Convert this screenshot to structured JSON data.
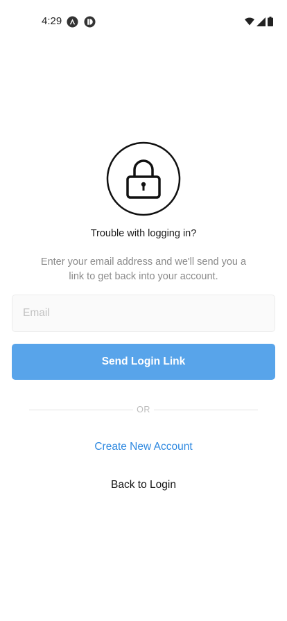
{
  "status_bar": {
    "time": "4:29",
    "icons": [
      "notification-a-icon",
      "notification-p-icon",
      "wifi-icon",
      "signal-icon",
      "battery-icon"
    ]
  },
  "lock": {
    "icon": "lock-icon"
  },
  "heading": "Trouble with logging in?",
  "description": "Enter your email address and we'll send you a link to get back into your account.",
  "email": {
    "placeholder": "Email",
    "value": ""
  },
  "send_button": {
    "label": "Send Login Link"
  },
  "divider": {
    "label": "OR"
  },
  "create_account": {
    "label": "Create New Account"
  },
  "back_to_login": {
    "label": "Back to Login"
  },
  "colors": {
    "accent": "#58a4ea",
    "link": "#2d88e0"
  }
}
